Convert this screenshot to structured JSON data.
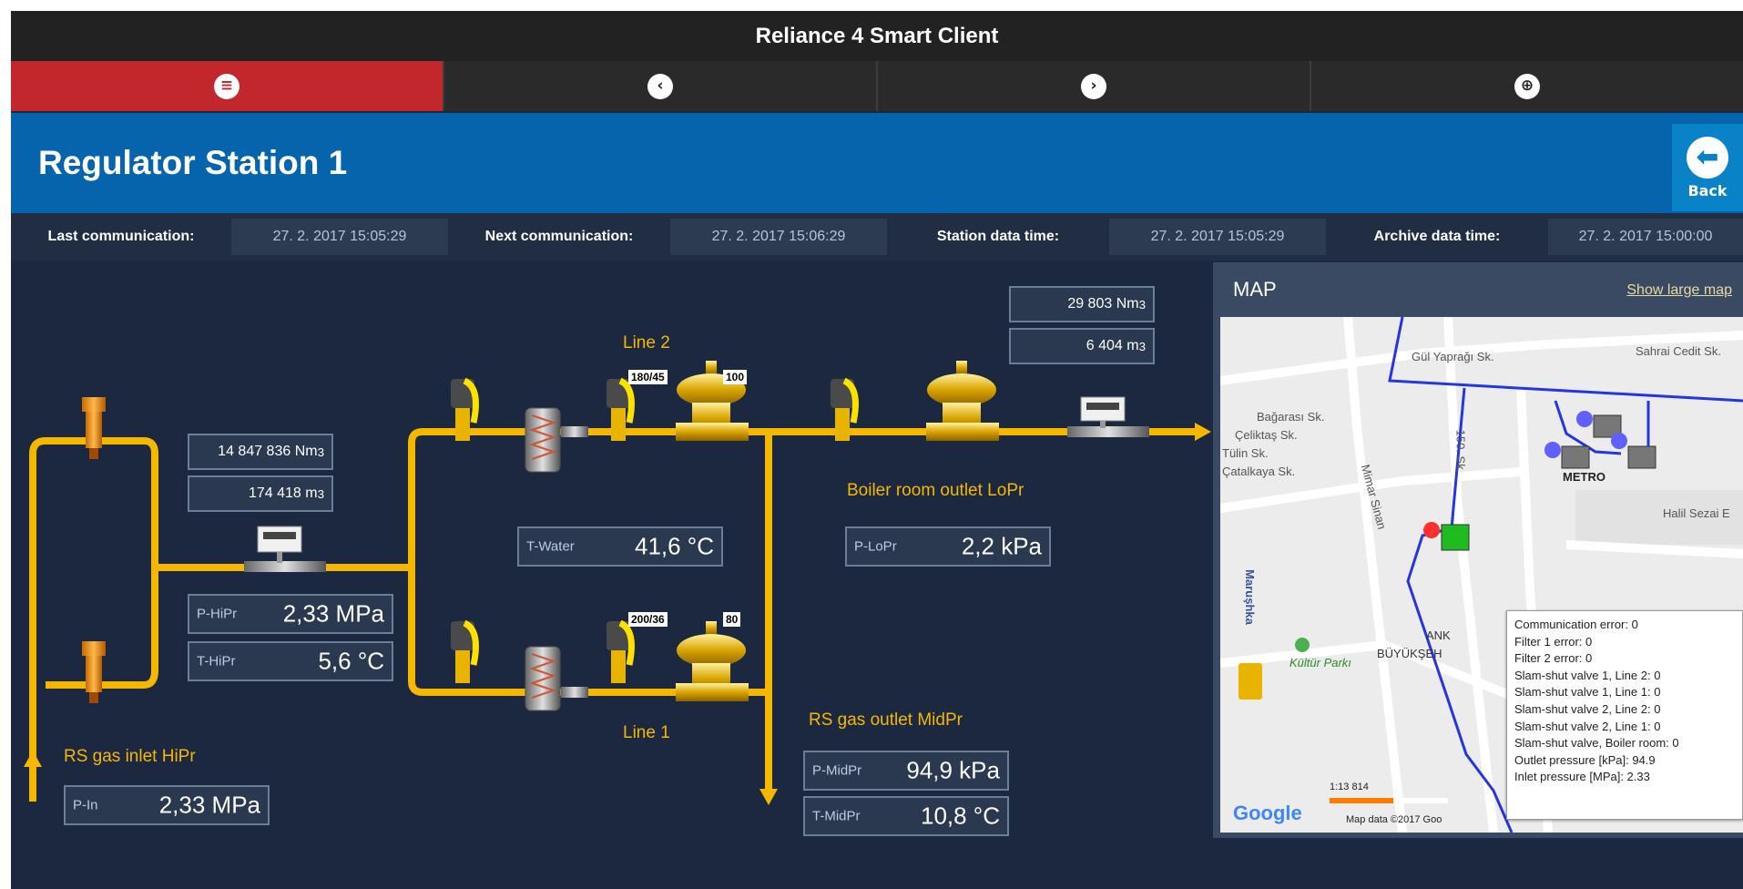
{
  "window": {
    "title": "Reliance 4 Smart Client"
  },
  "nav": {
    "items": [
      {
        "name": "menu",
        "glyph": "≡",
        "active": true
      },
      {
        "name": "back",
        "glyph": "‹",
        "active": false
      },
      {
        "name": "forward",
        "glyph": "›",
        "active": false
      },
      {
        "name": "zoom",
        "glyph": "⊕",
        "active": false
      }
    ]
  },
  "header": {
    "title": "Regulator Station 1",
    "back_label": "Back"
  },
  "status": {
    "last_comm_label": "Last communication:",
    "last_comm_value": "27. 2. 2017 15:05:29",
    "next_comm_label": "Next communication:",
    "next_comm_value": "27. 2. 2017 15:06:29",
    "station_time_label": "Station data time:",
    "station_time_value": "27. 2. 2017 15:05:29",
    "archive_time_label": "Archive data time:",
    "archive_time_value": "27. 2. 2017 15:00:00"
  },
  "diagram": {
    "counter1_nm3": "14 847 836 Nm",
    "counter1_m3": "174 418 m",
    "counter2_nm3": "29 803 Nm",
    "counter2_m3": "6 404 m",
    "sup": "3",
    "line2_label": "Line 2",
    "line1_label": "Line 1",
    "line2_tag1": "180/45",
    "line2_tag2": "100",
    "line1_tag1": "200/36",
    "line1_tag2": "80",
    "boiler_label": "Boiler room outlet LoPr",
    "inlet_label": "RS gas inlet HiPr",
    "outlet_label": "RS gas outlet MidPr",
    "phipr_label": "P-HiPr",
    "phipr_value": "2,33 MPa",
    "thipr_label": "T-HiPr",
    "thipr_value": "5,6 °C",
    "twater_label": "T-Water",
    "twater_value": "41,6 °C",
    "plopr_label": "P-LoPr",
    "plopr_value": "2,2 kPa",
    "pin_label": "P-In",
    "pin_value": "2,33 MPa",
    "pmidpr_label": "P-MidPr",
    "pmidpr_value": "94,9 kPa",
    "tmidpr_label": "T-MidPr",
    "tmidpr_value": "10,8 °C"
  },
  "map": {
    "title": "MAP",
    "link": "Show large map",
    "streets": [
      "Gül Yaprağı Sk.",
      "Sahrai Cedit Sk.",
      "Bağarası Sk.",
      "Çeliktaş Sk.",
      "Tülin Sk.",
      "Çatalkaya Sk.",
      "METRO",
      "Halil Sezai E",
      "Kültür Parkı",
      "BÜYÜKŞEH",
      "ANK",
      "150. Sk.",
      "Mimar Sinan",
      "Maruşhka"
    ],
    "scale": "1:13 814",
    "copyright": "Map data ©2017 Goo",
    "google": "Google",
    "tooltip": [
      "Communication error: 0",
      "Filter 1 error: 0",
      "Filter 2 error: 0",
      "Slam-shut valve 1, Line 2: 0",
      "Slam-shut valve 1, Line 1: 0",
      "Slam-shut valve 2, Line 2: 0",
      "Slam-shut valve 2, Line 1: 0",
      "Slam-shut valve, Boiler room: 0",
      "Outlet pressure [kPa]: 94.9",
      "Inlet pressure [MPa]: 2.33"
    ]
  },
  "colors": {
    "pipe": "#f5b700",
    "nav_active": "#c1272d",
    "header": "#0664ad",
    "background": "#1b2840"
  }
}
